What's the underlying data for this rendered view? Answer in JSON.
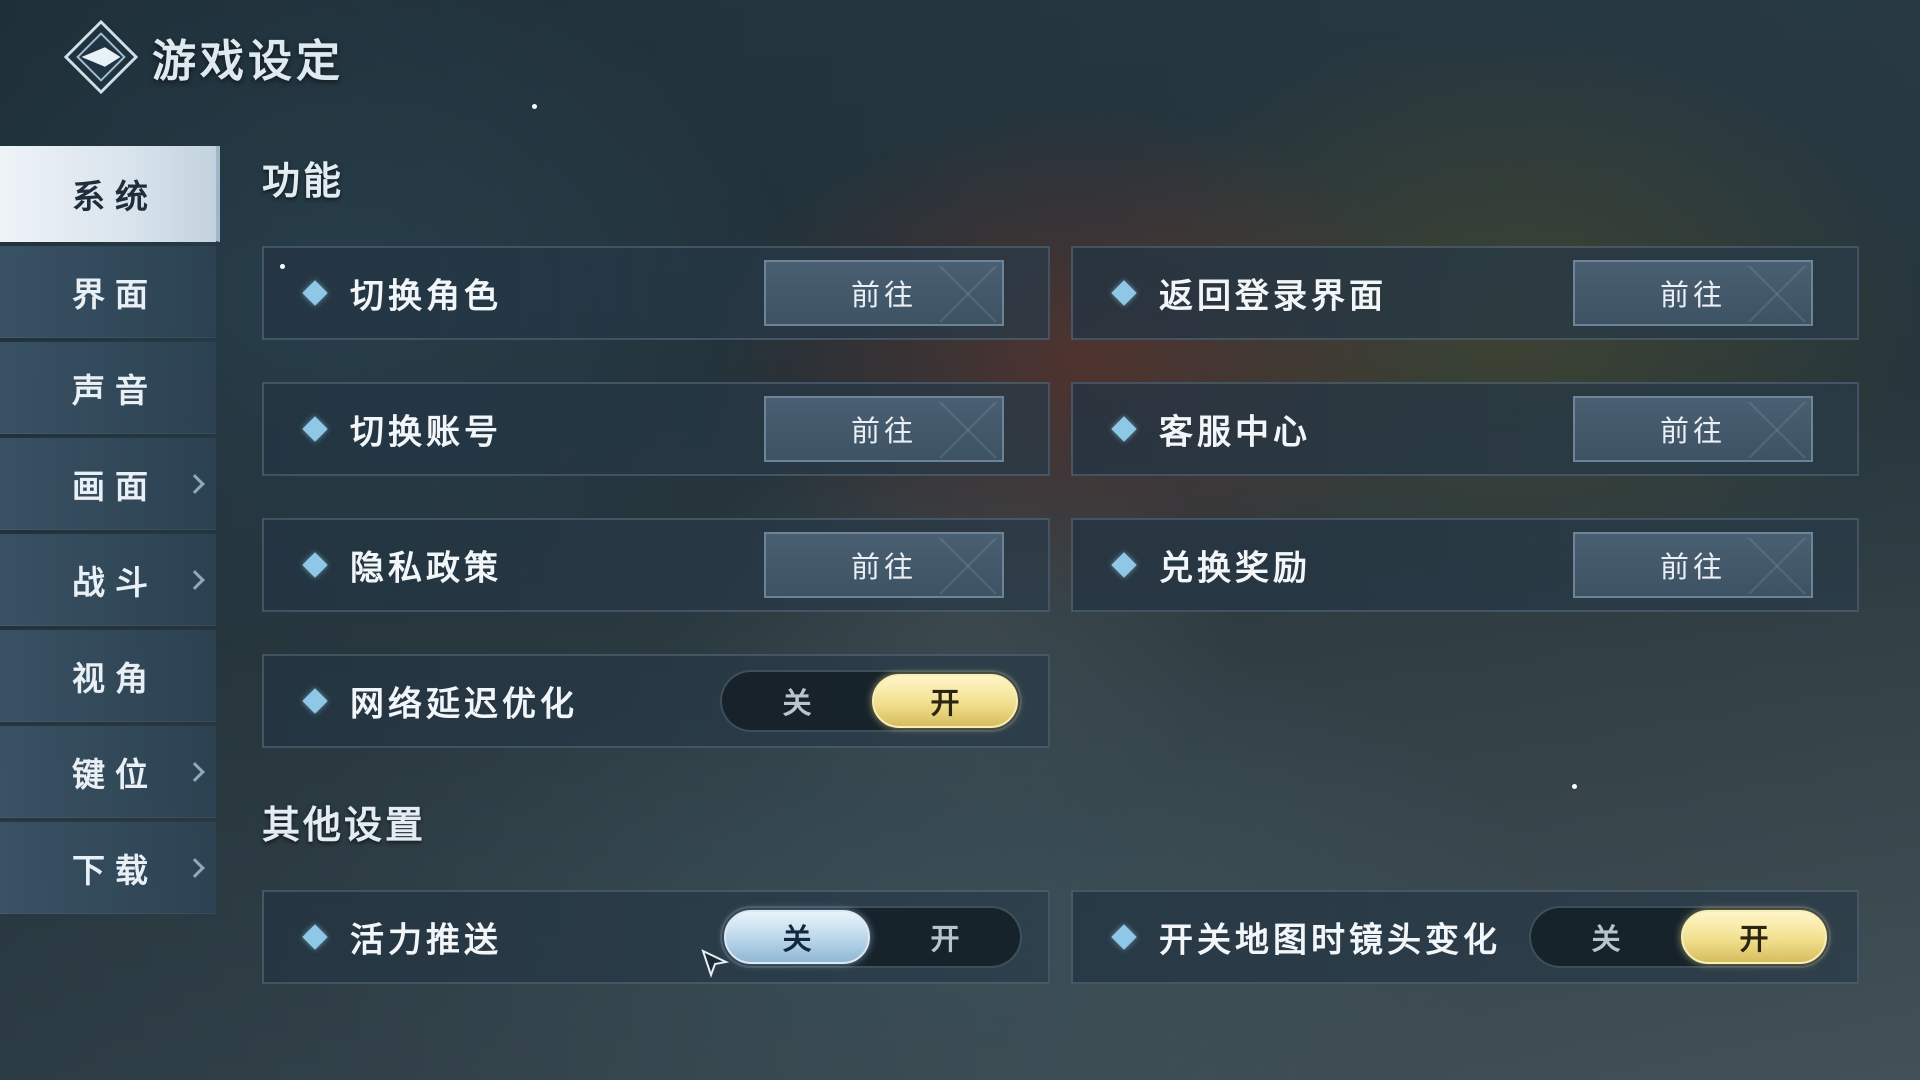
{
  "header": {
    "title": "游戏设定",
    "logo_icon": "diamond-emblem-icon"
  },
  "sidebar": {
    "items": [
      {
        "label": "系统",
        "active": true,
        "has_arrow": false
      },
      {
        "label": "界面",
        "active": false,
        "has_arrow": false
      },
      {
        "label": "声音",
        "active": false,
        "has_arrow": false
      },
      {
        "label": "画面",
        "active": false,
        "has_arrow": true
      },
      {
        "label": "战斗",
        "active": false,
        "has_arrow": true
      },
      {
        "label": "视角",
        "active": false,
        "has_arrow": false
      },
      {
        "label": "键位",
        "active": false,
        "has_arrow": true
      },
      {
        "label": "下载",
        "active": false,
        "has_arrow": true
      }
    ]
  },
  "sections": {
    "functions": {
      "title": "功能",
      "rows": [
        {
          "label": "切换角色",
          "button": "前往"
        },
        {
          "label": "返回登录界面",
          "button": "前往"
        },
        {
          "label": "切换账号",
          "button": "前往"
        },
        {
          "label": "客服中心",
          "button": "前往"
        },
        {
          "label": "隐私政策",
          "button": "前往"
        },
        {
          "label": "兑换奖励",
          "button": "前往"
        }
      ],
      "network": {
        "label": "网络延迟优化",
        "off": "关",
        "on": "开",
        "value": "on"
      }
    },
    "other": {
      "title": "其他设置",
      "vitality_push": {
        "label": "活力推送",
        "off": "关",
        "on": "开",
        "value": "off"
      },
      "map_camera": {
        "label": "开关地图时镜头变化",
        "off": "关",
        "on": "开",
        "value": "on"
      }
    }
  },
  "colors": {
    "toggle_on": "#f2e08e",
    "toggle_off_selected": "#b9d6ea",
    "diamond": "#8fc7e6"
  }
}
